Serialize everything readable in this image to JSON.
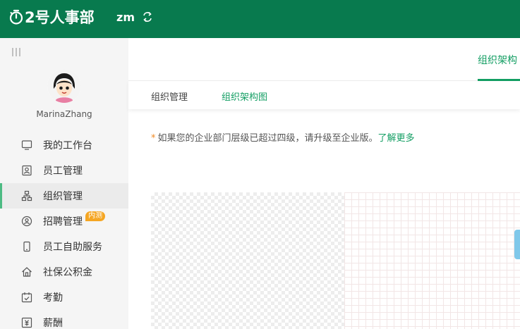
{
  "header": {
    "logo_text": "2号人事部",
    "company": "zm",
    "icons": {
      "logo": "stopwatch-icon",
      "switch": "switch-org-icon"
    },
    "colors": {
      "background": "#087a4e",
      "text": "#ffffff"
    }
  },
  "sidebar": {
    "username": "MarinaZhang",
    "collapse_icon": "menu-collapse-icon",
    "items": [
      {
        "label": "我的工作台",
        "icon": "monitor-icon"
      },
      {
        "label": "员工管理",
        "icon": "id-card-icon"
      },
      {
        "label": "组织管理",
        "icon": "org-tree-icon",
        "active": true
      },
      {
        "label": "招聘管理",
        "icon": "recruit-icon",
        "badge": "内测"
      },
      {
        "label": "员工自助服务",
        "icon": "phone-icon"
      },
      {
        "label": "社保公积金",
        "icon": "house-icon"
      },
      {
        "label": "考勤",
        "icon": "calendar-check-icon"
      },
      {
        "label": "薪酬",
        "icon": "salary-icon"
      }
    ],
    "colors": {
      "active_bar": "#4dbb83",
      "badge": "#f5a623"
    }
  },
  "main": {
    "top_tab": "组织架构",
    "sub_tabs": [
      {
        "label": "组织管理"
      },
      {
        "label": "组织架构图",
        "active": true
      }
    ],
    "notice": {
      "star": "*",
      "text": "如果您的企业部门层级已超过四级，请升级至企业版。",
      "link": "了解更多"
    },
    "colors": {
      "accent": "#139e63",
      "notice_star": "#f08a24"
    }
  }
}
